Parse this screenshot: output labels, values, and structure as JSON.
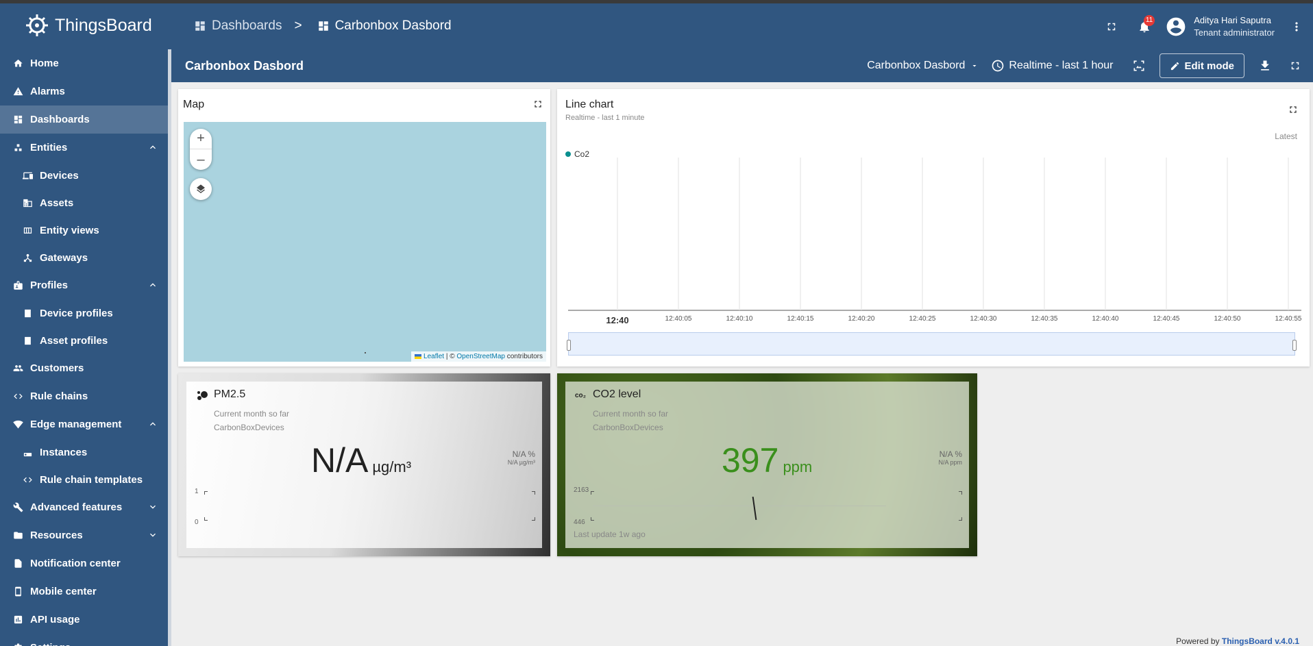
{
  "app": {
    "logo_text": "ThingsBoard"
  },
  "breadcrumb": {
    "item1": "Dashboards",
    "separator": ">",
    "item2": "Carbonbox Dasbord"
  },
  "header": {
    "notification_count": "11",
    "user_name": "Aditya Hari Saputra",
    "user_role": "Tenant administrator"
  },
  "sidebar": {
    "items": [
      {
        "label": "Home",
        "icon": "home-icon"
      },
      {
        "label": "Alarms",
        "icon": "warning-icon"
      },
      {
        "label": "Dashboards",
        "icon": "dashboard-icon",
        "active": true
      },
      {
        "label": "Entities",
        "icon": "entities-icon",
        "expanded": true
      },
      {
        "label": "Devices",
        "icon": "devices-icon",
        "sub": true
      },
      {
        "label": "Assets",
        "icon": "assets-icon",
        "sub": true
      },
      {
        "label": "Entity views",
        "icon": "entity-views-icon",
        "sub": true
      },
      {
        "label": "Gateways",
        "icon": "gateway-icon",
        "sub": true
      },
      {
        "label": "Profiles",
        "icon": "profiles-icon",
        "expanded": true
      },
      {
        "label": "Device profiles",
        "icon": "device-profile-icon",
        "sub": true
      },
      {
        "label": "Asset profiles",
        "icon": "asset-profile-icon",
        "sub": true
      },
      {
        "label": "Customers",
        "icon": "customers-icon"
      },
      {
        "label": "Rule chains",
        "icon": "rule-chain-icon"
      },
      {
        "label": "Edge management",
        "icon": "edge-icon",
        "expanded": true
      },
      {
        "label": "Instances",
        "icon": "instances-icon",
        "sub": true
      },
      {
        "label": "Rule chain templates",
        "icon": "rule-chain-icon",
        "sub": true
      },
      {
        "label": "Advanced features",
        "icon": "tools-icon",
        "collapsed": true
      },
      {
        "label": "Resources",
        "icon": "folder-icon",
        "collapsed": true
      },
      {
        "label": "Notification center",
        "icon": "notification-center-icon"
      },
      {
        "label": "Mobile center",
        "icon": "mobile-icon"
      },
      {
        "label": "API usage",
        "icon": "api-usage-icon"
      },
      {
        "label": "Settings",
        "icon": "settings-icon"
      }
    ]
  },
  "dashboard": {
    "title": "Carbonbox Dasbord",
    "selector": "Carbonbox Dasbord",
    "timewindow": "Realtime - last 1 hour",
    "edit_label": "Edit mode"
  },
  "map_widget": {
    "title": "Map",
    "attribution": {
      "leaflet": "Leaflet",
      "sep": " | © ",
      "osm": "OpenStreetMap",
      "suffix": " contributors"
    }
  },
  "line_chart": {
    "title": "Line chart",
    "subtitle": "Realtime - last 1 minute",
    "latest_label": "Latest"
  },
  "chart_data": {
    "type": "line",
    "title": "Line chart",
    "series": [
      {
        "name": "Co2",
        "values": []
      }
    ],
    "x_ticks": [
      "12:40",
      "12:40:05",
      "12:40:10",
      "12:40:15",
      "12:40:20",
      "12:40:25",
      "12:40:30",
      "12:40:35",
      "12:40:40",
      "12:40:45",
      "12:40:50",
      "12:40:55"
    ],
    "grid": true,
    "legend": "top-left",
    "series_color": "#0a8f8f"
  },
  "pm25": {
    "title": "PM2.5",
    "subtitle1": "Current month so far",
    "subtitle2": "CarbonBoxDevices",
    "value": "N/A",
    "unit": "µg/m³",
    "pct": "N/A %",
    "pct_sub": "N/A µg/m³",
    "axis_top": "1",
    "axis_bottom": "0"
  },
  "co2": {
    "title": "CO2 level",
    "subtitle1": "Current month so far",
    "subtitle2": "CarbonBoxDevices",
    "value": "397",
    "unit": "ppm",
    "value_color": "#3a8f1c",
    "pct": "N/A %",
    "pct_sub": "N/A ppm",
    "axis_top": "2163",
    "axis_bottom": "446",
    "last_update": "Last update 1w ago"
  },
  "footer": {
    "prefix": "Powered by ",
    "link": "ThingsBoard v.4.0.1"
  }
}
